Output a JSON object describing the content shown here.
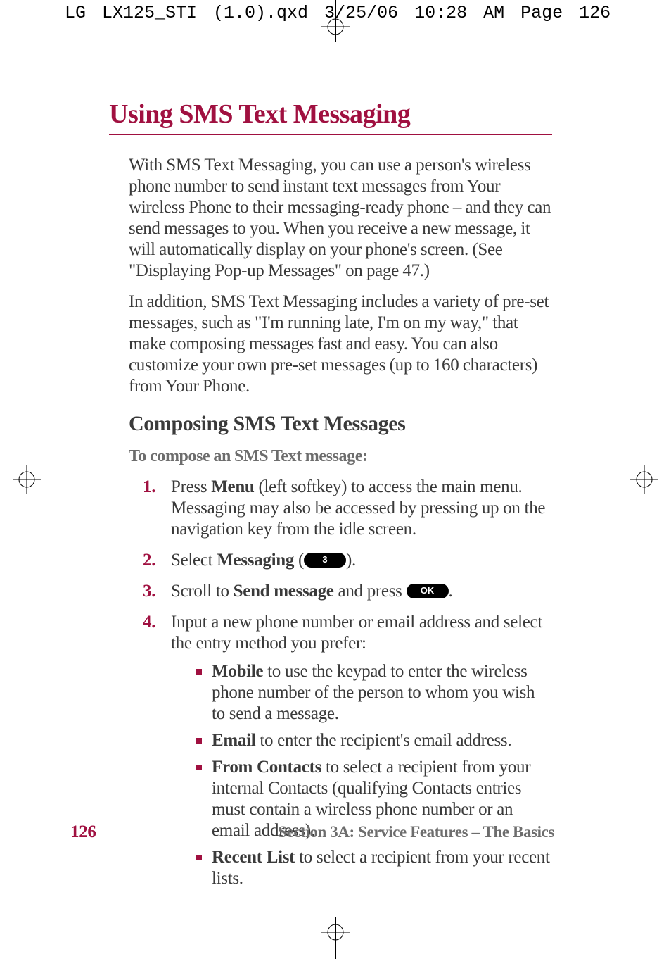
{
  "slug": "LG LX125_STI (1.0).qxd  3/25/06  10:28 AM  Page 126",
  "title": "Using SMS Text Messaging",
  "para1": "With SMS Text Messaging, you can use a person's wireless phone number to send instant text messages from Your wireless Phone to their messaging-ready phone – and they can send messages to you. When you receive a new message, it will automatically display on your phone's screen. (See \"Displaying Pop-up Messages\" on page 47.)",
  "para2": "In addition, SMS Text Messaging includes a variety of pre-set messages, such as \"I'm running late, I'm on my way,\" that make composing messages fast and easy. You can also customize your own pre-set messages (up to 160 characters) from Your Phone.",
  "subhead": "Composing SMS Text Messages",
  "procedure_lead": "To compose an SMS Text message:",
  "steps": {
    "s1": {
      "num": "1.",
      "pre": "Press ",
      "bold": "Menu",
      "post": " (left softkey) to access the main menu. Messaging may also be accessed by pressing up on the navigation key from the idle screen."
    },
    "s2": {
      "num": "2.",
      "pre": "Select ",
      "bold": "Messaging",
      "open_paren": " (",
      "key": "3",
      "close_paren": ")."
    },
    "s3": {
      "num": "3.",
      "pre": "Scroll to ",
      "bold": "Send message",
      "mid": " and press ",
      "key": "OK",
      "end": "."
    },
    "s4": {
      "num": "4.",
      "text": "Input a new phone number or email address and select the entry method you prefer:",
      "sub": {
        "a": {
          "bold": "Mobile",
          "text": " to use the keypad to enter the wireless phone number of the person to whom you wish to send a message."
        },
        "b": {
          "bold": "Email",
          "text": " to enter the recipient's email address."
        },
        "c": {
          "bold": "From Contacts",
          "text": " to select a recipient from your internal Contacts (qualifying Contacts entries must contain a wireless phone number or an email address)."
        },
        "d": {
          "bold": "Recent List",
          "text": " to select a recipient from your recent lists."
        }
      }
    }
  },
  "footer": {
    "page_number": "126",
    "section": "Section 3A: Service Features – The Basics"
  }
}
